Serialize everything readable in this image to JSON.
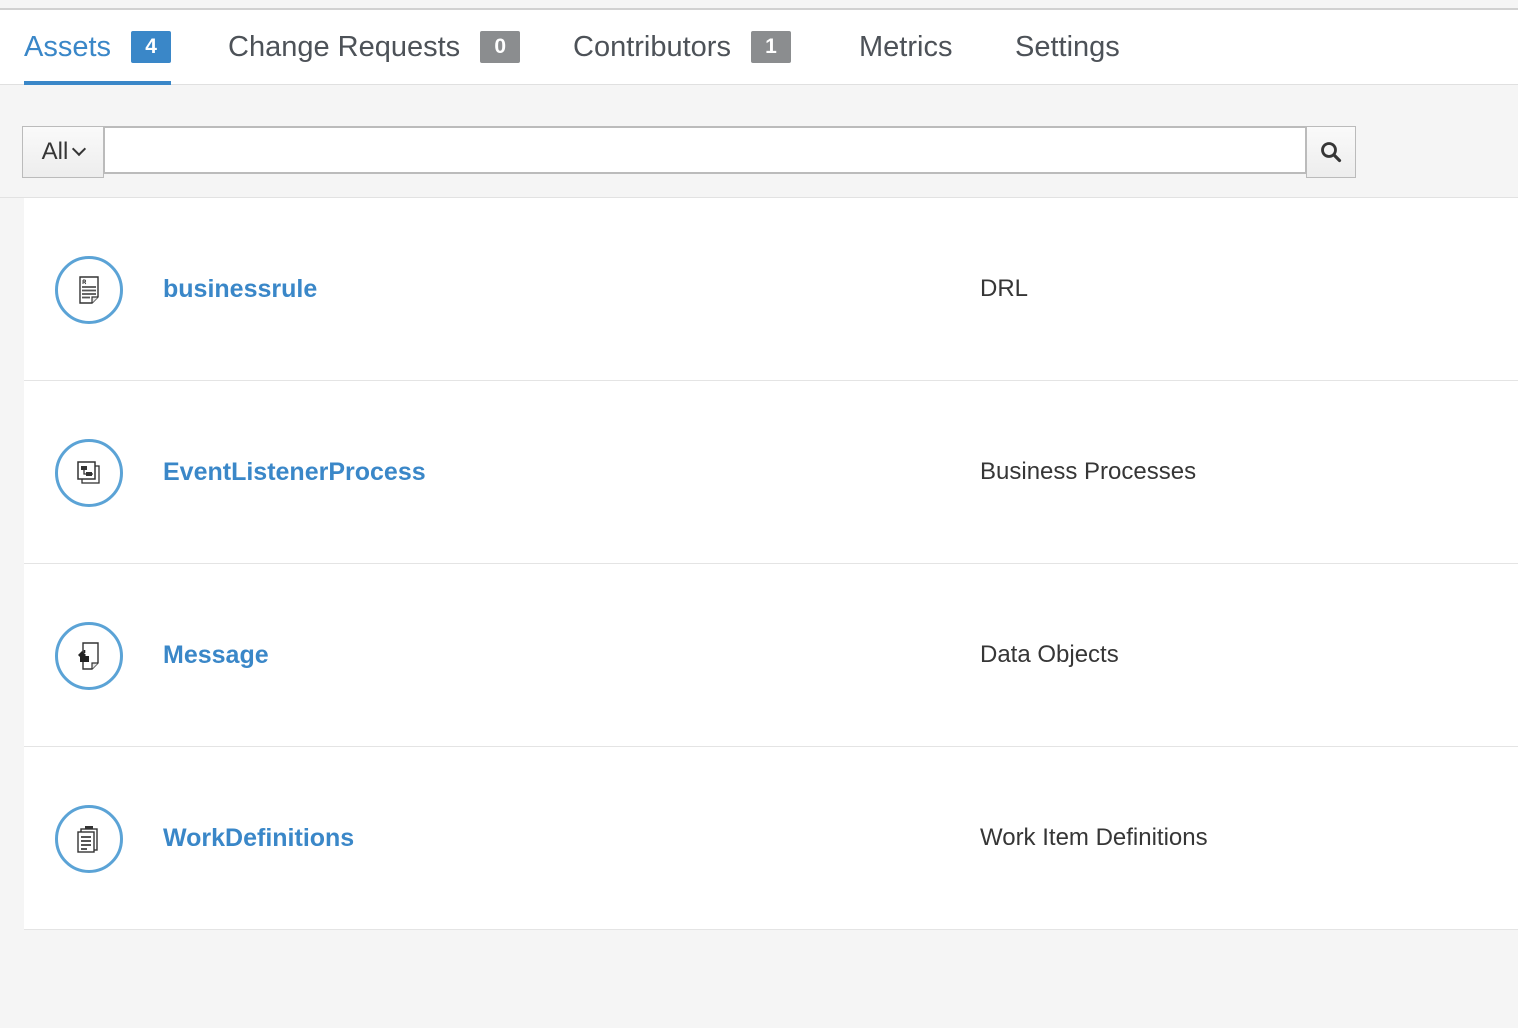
{
  "tabs": [
    {
      "label": "Assets",
      "badge": "4",
      "active": true
    },
    {
      "label": "Change Requests",
      "badge": "0"
    },
    {
      "label": "Contributors",
      "badge": "1"
    },
    {
      "label": "Metrics"
    },
    {
      "label": "Settings"
    }
  ],
  "search": {
    "filter_label": "All",
    "value": "",
    "filter_icon": "chevron-down-icon",
    "button_icon": "search-icon"
  },
  "assets": [
    {
      "name": "businessrule",
      "type": "DRL",
      "icon": "drl-rule-icon"
    },
    {
      "name": "EventListenerProcess",
      "type": "Business Processes",
      "icon": "business-process-icon"
    },
    {
      "name": "Message",
      "type": "Data Objects",
      "icon": "data-object-icon"
    },
    {
      "name": "WorkDefinitions",
      "type": "Work Item Definitions",
      "icon": "work-item-definition-icon"
    }
  ],
  "colors": {
    "accent": "#3a87c8",
    "icon_ring": "#5ba3d6",
    "badge_inactive": "#8b8d8f",
    "background": "#f5f5f5"
  }
}
